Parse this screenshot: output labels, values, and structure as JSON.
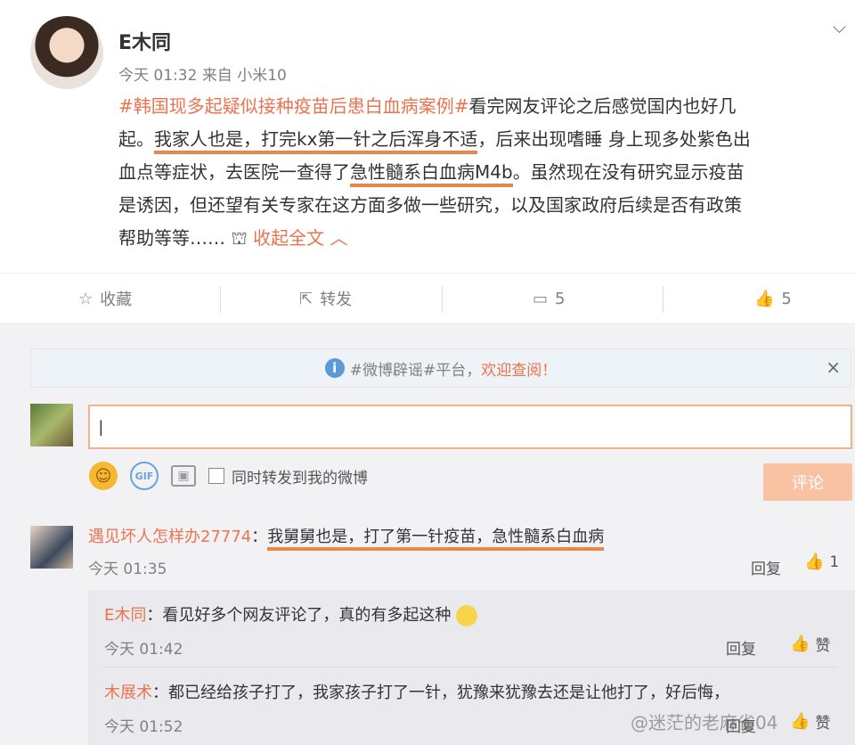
{
  "post": {
    "author": "E木同",
    "time": "今天 01:32",
    "source_prefix": "来自",
    "source": "小米10",
    "hashtag": "#韩国现多起疑似接种疫苗后患白血病案例#",
    "text_1": "看完网友评论之后感觉国内也好几",
    "text_2": "起。",
    "underline_1": "我家人也是，打完kx第一针之后浑身不适",
    "text_3": "，后来出现嗜睡 身上现多处紫色出",
    "text_4": "血点等症状，去医院一查得了",
    "underline_2": "急性髓系白血病M4b",
    "text_5": "。虽然现在没有研究显示疫苗",
    "text_6": "是诱因，但还望有关专家在这方面多做一些研究，以及国家政府后续是否有政策",
    "text_7": "帮助等等……",
    "collapse": "收起全文",
    "chevron_icon": "chevron-down-icon"
  },
  "actions": {
    "favorite": "收藏",
    "repost": "转发",
    "comment_count": "5",
    "like_count": "5"
  },
  "notice": {
    "text_prefix": "#微博辟谣#平台，",
    "highlight": "欢迎查阅！",
    "close": "×"
  },
  "composer": {
    "input_value": "|",
    "repost_checkbox_label": "同时转发到我的微博",
    "submit_label": "评论"
  },
  "comments": [
    {
      "name": "遇见坏人怎样办27774",
      "sep": "：",
      "text": "我舅舅也是，打了第一针疫苗，急性髓系白血病",
      "time": "今天 01:35",
      "reply_label": "回复",
      "like_count": "1"
    }
  ],
  "replies": [
    {
      "name": "E木同",
      "sep": "：",
      "text": "看见好多个网友评论了，真的有多起这种",
      "time": "今天 01:42",
      "reply_label": "回复",
      "like_label": "赞"
    },
    {
      "name": "木展术",
      "sep": "：",
      "text": "都已经给孩子打了，我家孩子打了一针，犹豫来犹豫去还是让他打了，好后悔，",
      "time": "今天 01:52",
      "reply_label": "回复",
      "like_label": "赞"
    }
  ],
  "watermark": "@迷茫的老麻雀04"
}
